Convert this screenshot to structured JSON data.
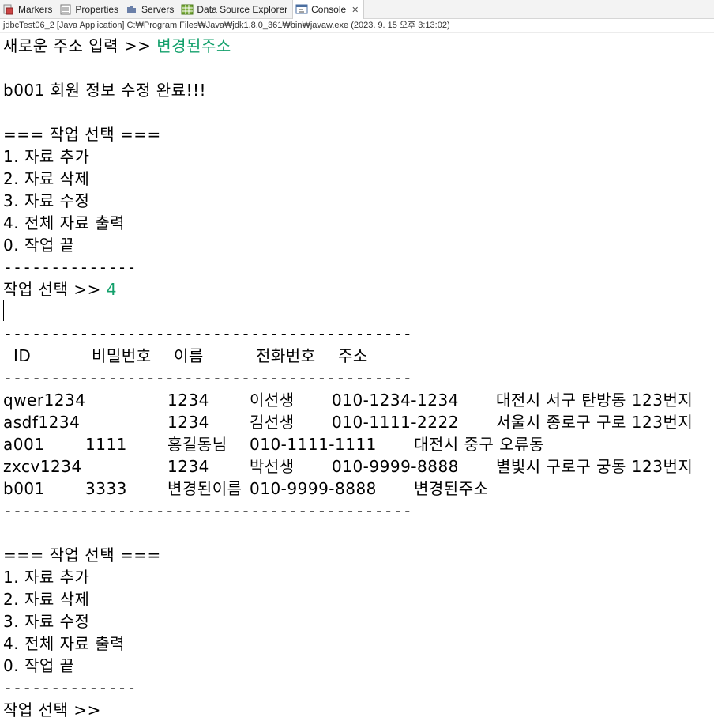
{
  "tabs": [
    {
      "label": "Markers",
      "icon": "markers-icon"
    },
    {
      "label": "Properties",
      "icon": "properties-icon"
    },
    {
      "label": "Servers",
      "icon": "servers-icon"
    },
    {
      "label": "Data Source Explorer",
      "icon": "data-source-explorer-icon"
    },
    {
      "label": "Console",
      "icon": "console-icon",
      "active": true,
      "close": "✕"
    }
  ],
  "launch_info": "jdbcTest06_2 [Java Application] C:₩Program Files₩Java₩jdk1.8.0_361₩bin₩javaw.exe  (2023. 9. 15 오후 3:13:02)",
  "colors": {
    "input_text": "#13a06b"
  },
  "console": {
    "prompt_new_address": "새로운 주소 입력 >> ",
    "input_new_address": "변경된주소",
    "update_done": "b001 회원 정보 수정 완료!!!",
    "menu1": {
      "title": "=== 작업 선택 ===",
      "items": [
        "1. 자료 추가",
        "2. 자료 삭제",
        "3. 자료 수정",
        "4. 전체 자료 출력",
        "0. 작업 끝"
      ],
      "divider": "--------------",
      "prompt": "작업 선택 >> ",
      "input": "4"
    },
    "table": {
      "rule": "-------------------------------------------",
      "headers": [
        "ID",
        "비밀번호",
        "이름",
        "전화번호",
        "주소"
      ],
      "rows": [
        [
          "qwer1234",
          "1234",
          "이선생",
          "010-1234-1234",
          "대전시 서구 탄방동 123번지"
        ],
        [
          "asdf1234",
          "1234",
          "김선생",
          "010-1111-2222",
          "서울시 종로구 구로 123번지"
        ],
        [
          "a001",
          "1111",
          "홍길동님",
          "010-1111-1111",
          "대전시 중구 오류동"
        ],
        [
          "zxcv1234",
          "1234",
          "박선생",
          "010-9999-8888",
          "별빛시 구로구 궁동 123번지"
        ],
        [
          "b001",
          "3333",
          "변경된이름",
          "010-9999-8888",
          "변경된주소"
        ]
      ]
    },
    "menu2": {
      "title": "=== 작업 선택 ===",
      "items": [
        "1. 자료 추가",
        "2. 자료 삭제",
        "3. 자료 수정",
        "4. 전체 자료 출력",
        "0. 작업 끝"
      ],
      "divider": "--------------",
      "prompt": "작업 선택 >> "
    }
  }
}
